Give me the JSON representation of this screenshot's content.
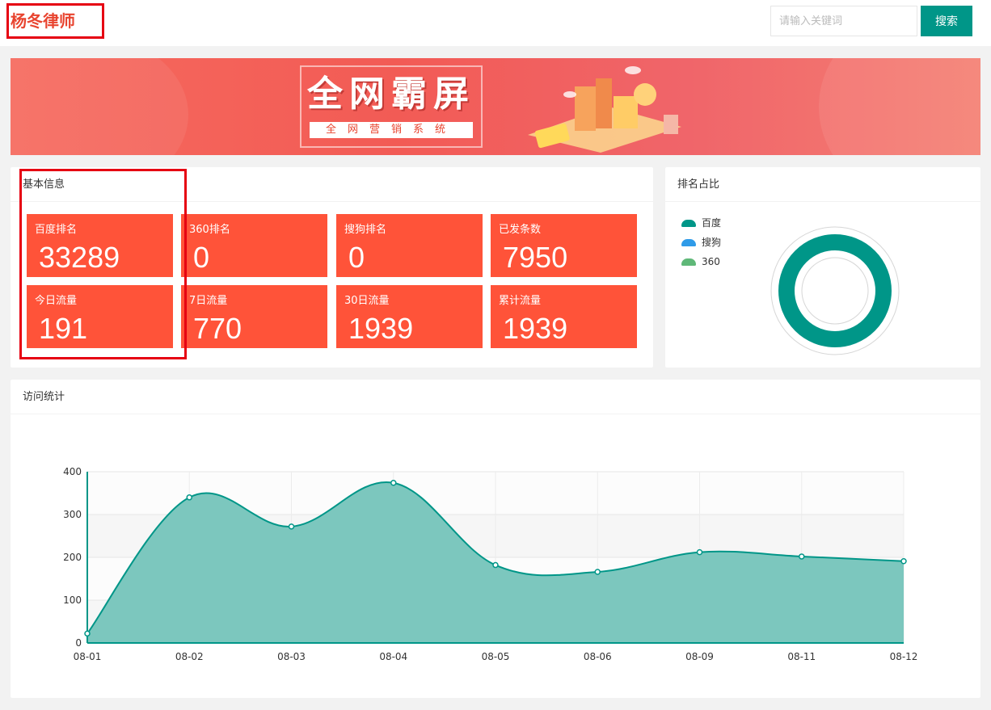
{
  "header": {
    "brand": "杨冬律师",
    "search_placeholder": "请输入关键词",
    "search_button": "搜索"
  },
  "banner": {
    "title": "全网霸屏",
    "subtitle": "全网营销系统"
  },
  "basic_info": {
    "title": "基本信息",
    "stats": [
      {
        "label": "百度排名",
        "value": "33289"
      },
      {
        "label": "360排名",
        "value": "0"
      },
      {
        "label": "搜狗排名",
        "value": "0"
      },
      {
        "label": "已发条数",
        "value": "7950"
      },
      {
        "label": "今日流量",
        "value": "191"
      },
      {
        "label": "7日流量",
        "value": "770"
      },
      {
        "label": "30日流量",
        "value": "1939"
      },
      {
        "label": "累计流量",
        "value": "1939"
      }
    ]
  },
  "rank_ratio": {
    "title": "排名占比",
    "legend": [
      {
        "name": "百度",
        "color": "#009688"
      },
      {
        "name": "搜狗",
        "color": "#2f9be8"
      },
      {
        "name": "360",
        "color": "#5fb878"
      }
    ]
  },
  "visit_stats": {
    "title": "访问统计"
  },
  "chart_data": {
    "type": "area",
    "categories": [
      "08-01",
      "08-02",
      "08-03",
      "08-04",
      "08-05",
      "08-06",
      "08-09",
      "08-11",
      "08-12"
    ],
    "values": [
      22,
      340,
      272,
      374,
      182,
      166,
      212,
      202,
      191
    ],
    "ylim": [
      0,
      400
    ],
    "yticks": [
      "0",
      "100",
      "200",
      "300",
      "400"
    ],
    "color": "#009688",
    "fill": "#7cc7be",
    "grid": true,
    "smooth": true
  }
}
